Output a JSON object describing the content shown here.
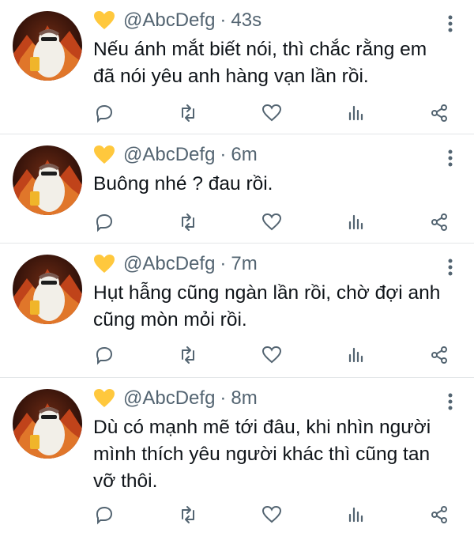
{
  "tweets": [
    {
      "handle": "@AbcDefg",
      "separator": "·",
      "time": "43s",
      "text": "Nếu ánh mắt biết nói, thì chắc rằng em đã nói yêu anh hàng vạn lần rồi."
    },
    {
      "handle": "@AbcDefg",
      "separator": "·",
      "time": "6m",
      "text": "Buông nhé ? đau rồi."
    },
    {
      "handle": "@AbcDefg",
      "separator": "·",
      "time": "7m",
      "text": "Hụt hẫng cũng ngàn lần rồi, chờ đợi anh cũng mòn mỏi rồi."
    },
    {
      "handle": "@AbcDefg",
      "separator": "·",
      "time": "8m",
      "text": "Dù có mạnh mẽ tới đâu, khi nhìn người mình thích yêu người khác thì cũng tan vỡ thôi."
    }
  ],
  "icons": {
    "name_emoji": "yellow-heart-icon",
    "more": "more-vertical-icon",
    "reply": "reply-icon",
    "retweet": "retweet-icon",
    "like": "like-icon",
    "views": "views-icon",
    "share": "share-icon"
  },
  "colors": {
    "icon": "#536471",
    "heart_emoji": "#FFC83D",
    "text": "#0f1419",
    "divider": "#e3e6e8"
  }
}
